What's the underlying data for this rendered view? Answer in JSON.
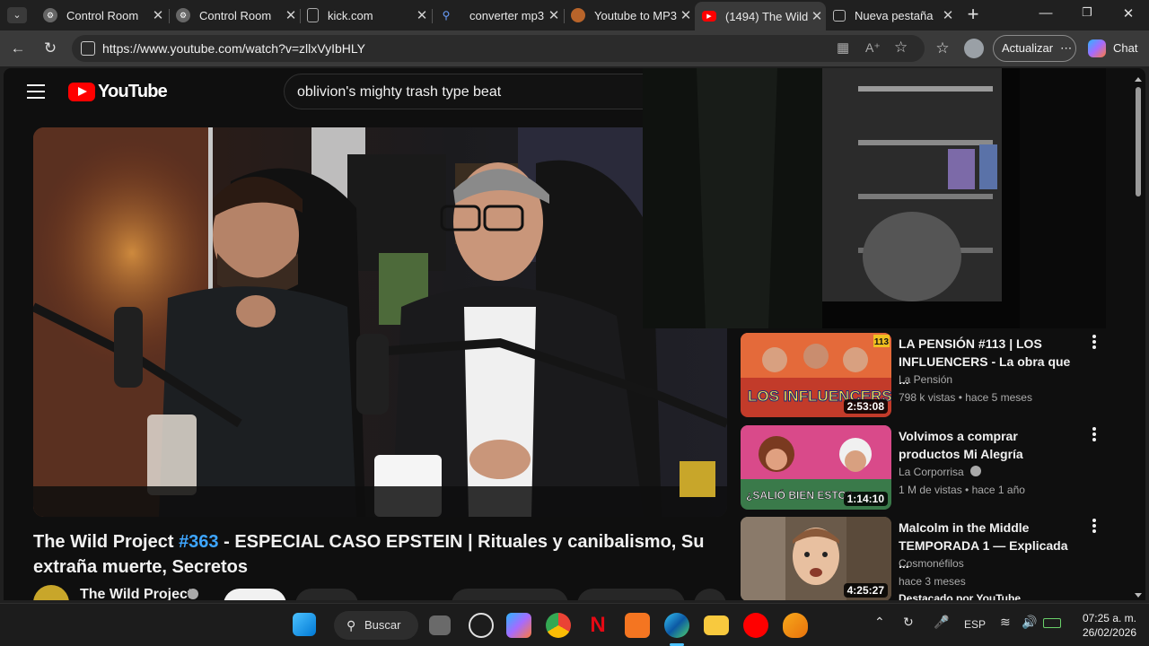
{
  "browser": {
    "tabs": [
      {
        "title": "Control Room",
        "active": false
      },
      {
        "title": "Control Room",
        "active": false
      },
      {
        "title": "kick.com",
        "active": false
      },
      {
        "title": "converter mp3 -",
        "active": false
      },
      {
        "title": "Youtube to MP3",
        "active": false
      },
      {
        "title": "(1494) The Wild",
        "active": true
      },
      {
        "title": "Nueva pestaña",
        "active": false
      }
    ],
    "new_tab": "+",
    "url": "https://www.youtube.com/watch?v=zllxVyIbHLY",
    "update_label": "Actualizar",
    "chat_label": "Chat"
  },
  "youtube": {
    "logo_text": "YouTube",
    "search_query": "oblivion's mighty trash type beat",
    "video": {
      "title_prefix": "The Wild Project ",
      "title_tag": "#363",
      "title_rest": " - ESPECIAL CASO EPSTEIN | Rituales y canibalismo, Su extraña muerte, Secretos",
      "channel": "The Wild Project"
    },
    "recommendations": [
      {
        "title": "LA PENSIÓN #113 | LOS INFLUENCERS - La obra que ...",
        "channel": "La Pensión",
        "meta": "798 k vistas • hace 5 meses",
        "duration": "2:53:08",
        "thumb_text": "LOS INFLUENCERS",
        "badge": "113"
      },
      {
        "title": "Volvimos a comprar productos Mi Alegría",
        "channel": "La Corporrisa",
        "meta": "1 M de vistas • hace 1 año",
        "duration": "1:14:10",
        "thumb_text": "¿SALIÓ BIEN ESTO?"
      },
      {
        "title": "Malcolm in the Middle TEMPORADA 1 — Explicada ...",
        "channel": "Cosmonéfilos",
        "meta": "hace 3 meses",
        "extra": "Destacado por YouTube",
        "duration": "4:25:27"
      }
    ]
  },
  "taskbar": {
    "search_label": "Buscar",
    "language": "ESP",
    "time": "07:25 a. m.",
    "date": "26/02/2026"
  }
}
